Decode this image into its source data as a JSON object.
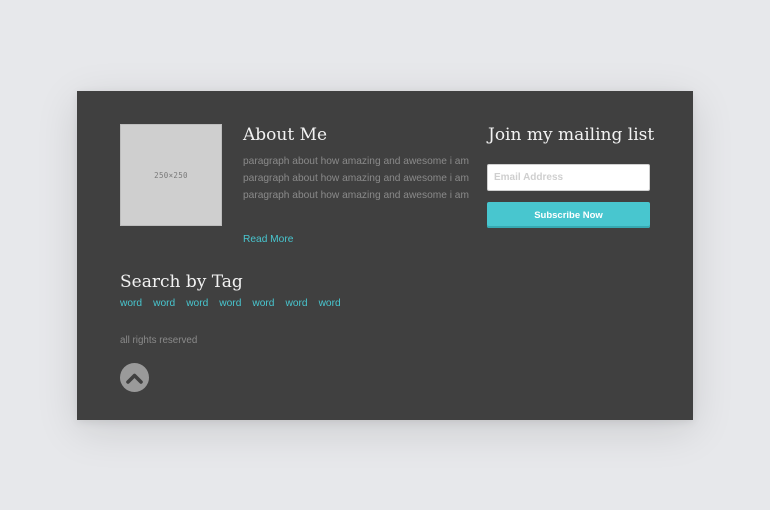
{
  "about": {
    "image_placeholder": "250×250",
    "title": "About Me",
    "paragraph": "paragraph about how amazing and awesome i am paragraph about how amazing and awesome i am paragraph about how amazing and awesome i am",
    "read_more": "Read More"
  },
  "mailing": {
    "title": "Join my mailing list",
    "email_placeholder": "Email Address",
    "subscribe_label": "Subscribe Now"
  },
  "tags": {
    "title": "Search by Tag",
    "items": [
      "word",
      "word",
      "word",
      "word",
      "word",
      "word",
      "word"
    ]
  },
  "footer": {
    "copyright": "all rights reserved",
    "back_to_top_icon": "chevron-up-icon"
  },
  "colors": {
    "accent": "#48c6cf",
    "panel": "#404040",
    "background": "#e7e8eb"
  }
}
